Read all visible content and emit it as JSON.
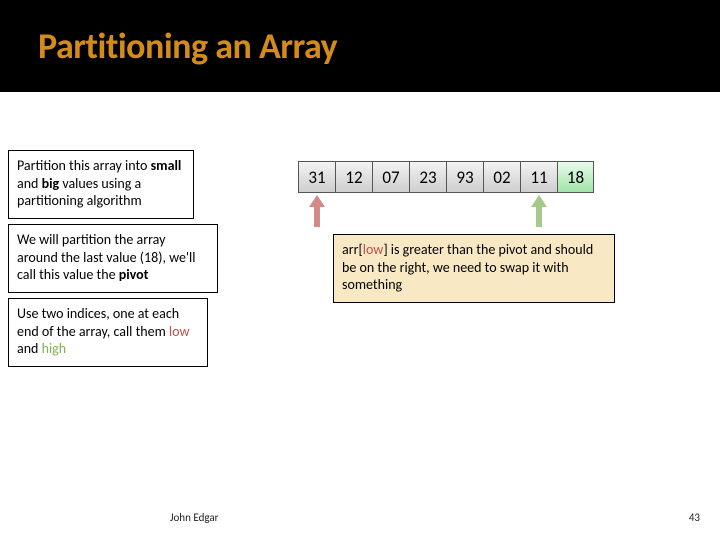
{
  "title": "Partitioning an Array",
  "boxes": {
    "intro": {
      "pre": "Partition this array into ",
      "bold1": "small",
      "mid": " and ",
      "bold2": "big",
      "post": " values using a partitioning algorithm"
    },
    "pivot": {
      "pre": "We will partition the array around the last value (18), we'll call this value the ",
      "bold": "pivot"
    },
    "indices": {
      "pre": "Use two indices, one at each end of the array, call them ",
      "low": "low",
      "and": " and ",
      "high": "high"
    },
    "note": {
      "pre": "arr[",
      "low": "low",
      "post1": "] is greater than the pivot and should be on the right, we need to swap it with something"
    }
  },
  "array": [
    "31",
    "12",
    "07",
    "23",
    "93",
    "02",
    "11",
    "18"
  ],
  "footer": {
    "author": "John Edgar",
    "page": "43"
  }
}
